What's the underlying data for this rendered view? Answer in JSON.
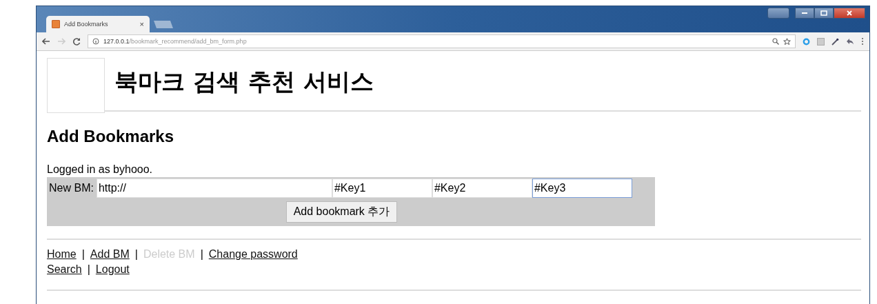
{
  "browser": {
    "tab": {
      "title": "Add Bookmarks",
      "close": "×"
    },
    "url_host": "127.0.0.1",
    "url_path": "/bookmark_recommend/add_bm_form.php"
  },
  "header": {
    "title": "북마크 검색 추천 서비스"
  },
  "heading": "Add Bookmarks",
  "login_text": "Logged in as byhooo.",
  "form": {
    "label": "New BM:",
    "fields": [
      {
        "value": "http://",
        "focused": false
      },
      {
        "value": "#Key1",
        "focused": false
      },
      {
        "value": "#Key2",
        "focused": false
      },
      {
        "value": "#Key3",
        "focused": true
      }
    ],
    "submit": "Add bookmark 추가"
  },
  "nav": [
    [
      {
        "kind": "link",
        "text": "Home",
        "disabled": false
      },
      {
        "kind": "sep",
        "text": "|"
      },
      {
        "kind": "link",
        "text": "Add BM",
        "disabled": false
      },
      {
        "kind": "sep",
        "text": "|"
      },
      {
        "kind": "link",
        "text": "Delete BM",
        "disabled": true
      },
      {
        "kind": "sep",
        "text": "|"
      },
      {
        "kind": "link",
        "text": "Change password",
        "disabled": false
      }
    ],
    [
      {
        "kind": "link",
        "text": "Search",
        "disabled": false
      },
      {
        "kind": "sep",
        "text": "|"
      },
      {
        "kind": "link",
        "text": "Logout",
        "disabled": false
      }
    ]
  ]
}
